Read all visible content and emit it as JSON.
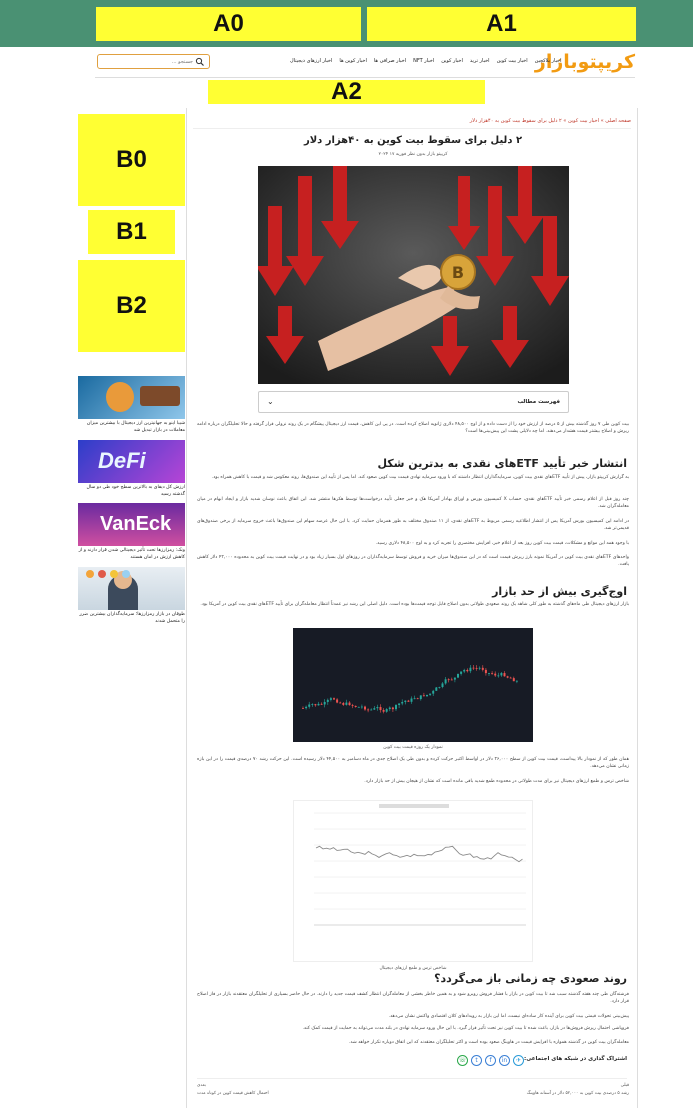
{
  "ads": {
    "a0": "A0",
    "a1": "A1",
    "a2": "A2",
    "b0": "B0",
    "b1": "B1",
    "b2": "B2"
  },
  "header": {
    "logo_a": "کریپتو",
    "logo_b": "بازار",
    "nav": [
      "اخبار ارزهای دیجیتال",
      "اخبار کوین ها",
      "اخبار صرافی ها",
      "اخبار NFT",
      "اخبار کوین",
      "اخبار ترید",
      "اخبار بیت کوین",
      "اخبار بلاکچین"
    ],
    "search_placeholder": "جستجو ..."
  },
  "article": {
    "breadcrumb": "صفحه اصلی » اخبار بیت کوین » ۲ دلیل برای سقوط بیت کوین به ۴۰هزار دلار",
    "title": "۲ دلیل برای سقوط بیت کوین به ۴۰هزار دلار",
    "meta": "کریپتو بازار   بدون نظر   فوریه ۱۷ ۲۰۲۴",
    "toc": "فهرست مطالب",
    "toc_chevron": "⌄",
    "intro": "بیت کوین طی ۷ روز گذشته بیش از ۵ درصد از ارزش خود را از دست داده و از اوج ۴۸,۵۰۰ دلاری ژانویه اصلاح کرده است. در پی این کاهش، قیمت ارز دیجیتال پیشگام در یک روند نزولی قرار گرفته و حالا تحلیلگران درباره ادامه ریزش و اصلاح بیشتر قیمت هشدار می‌دهند. اما چه دلایلی پشت این پیش‌بینی‌ها است؟",
    "h2_1": "انتشار خبر تأیید ETFهای نقدی به بدترین شکل",
    "p1": "به گزارش کریپتو بازار، پیش از تأیید ETFهای نقدی بیت کوین، سرمایه‌گذاران انتظار داشتند که با ورود سرمایه نهادی قیمت بیت کوین صعود کند. اما پس از تأیید این صندوق‌ها، روند معکوس شد و قیمت با کاهش همراه بود.",
    "p2": "چند روز قبل از اعلام رسمی خبر تأیید ETFهای نقدی، حساب X کمیسیون بورس و اوراق بهادار آمریکا هک و خبر جعلی تأیید درخواست‌ها توسط هکرها منتشر شد. این اتفاق باعث نوسان شدید بازار و ایجاد ابهام در میان معامله‌گران شد.",
    "p3": "در ادامه این کمیسیون بورس آمریکا پس از انتشار اطلاعیه رسمی مربوط به ETFهای نقدی، از ۱۱ صندوق مختلف به طور همزمان حمایت کرد. با این حال عرضه سهام این صندوق‌ها باعث خروج سرمایه از برخی صندوق‌های قدیمی‌تر شد.",
    "p4": "با وجود همه این موانع و مشکلات، قیمت بیت کوین روز بعد از اعلام خبر، افزایش مختصری را تجربه کرد و به اوج ۴۸,۵۰۰ دلاری رسید.",
    "p5": "واحدهای ETFهای نقدی بیت کوین در آمریکا نمونه بارز ریزش قیمت است که در این صندوق‌ها میزان خرید و فروش توسط سرمایه‌گذاران در روزهای اول بسیار زیاد بود و در نهایت قیمت بیت کوین به محدوده ۴۲,۰۰۰ دلار کاهش یافت.",
    "h2_2": "اوج‌گیری بیش از حد بازار",
    "p6": "بازار ارزهای دیجیتال طی ماه‌های گذشته به طور کلی شاهد یک روند صعودی طولانی بدون اصلاح قابل توجه قیمت‌ها بوده است. دلیل اصلی این رشد نیز عمدتاً انتظار معامله‌گران برای تأیید ETFهای نقدی بیت کوین در آمریکا بود.",
    "cap1": "نمودار یک روزه قیمت بیت کوین",
    "p7": "همان طور که از نمودار بالا پیداست، قیمت بیت کوین از سطح ۲۶,۰۰۰ دلار در اواسط اکتبر حرکت کرده و بدون طی یک اصلاح جدی در ماه دسامبر به ۴۴,۵۰۰ دلار رسیده است. این حرکت رشد ۷۰ درصدی قیمت را در این بازه زمانی نشان می‌دهد.",
    "p8": "شاخص ترس و طمع ارزهای دیجیتال نیز برای مدت طولانی در محدوده طمع شدید باقی مانده است که نشان از هیجان بیش از حد بازار دارد.",
    "cap2": "شاخص ترس و طمع ارزهای دیجیتال",
    "h2_3": "روند صعودی چه زمانی باز می‌گردد؟",
    "p9": "فرشته‌گان طی چند هفته گذشته سبب شد تا بیت کوین در بازار با فشار فروش روبرو شود و به همین خاطر بخشی از معامله‌گران انتظار کشف قیمت جدید را دارند. در حال حاضر بسیاری از تحلیلگران معتقدند بازار در فاز اصلاح قرار دارد.",
    "p10": "پیش‌بینی تحولات قیمتی بیت کوین برای آینده کار ساده‌ای نیست، اما این بازار به رویدادهای کلان اقتصادی واکنش نشان می‌دهد.",
    "p11": "فروپاشی احتمال ریزش فروش‌ها در بازار، باعث شده تا بیت کوین نیز تحت تأثیر قرار گیرد. با این حال ورود سرمایه نهادی در بلند مدت می‌تواند به حمایت از قیمت کمک کند.",
    "p12": "معامله‌گران بیت کوین در گذشته همواره با افزایش قیمت در هاوینگ صعود بوده است و اکثر تحلیلگران معتقدند که این اتفاق دوباره تکرار خواهد شد.",
    "share": "اشتراک گذاری در شبکه های اجتماعی:",
    "foot1": "قبلی",
    "foot2": "رشد ۵ درصدی بیت کوین به ۵۲,۰۰۰ دلار در آستانه هاوینگ",
    "foot3": "بعدی",
    "foot4": "احتمال کاهش قیمت کوین در کوتاه مدت"
  },
  "sidebar": [
    {
      "caption": "شیبا اینو به جهانیترین ارز دیجیتال با بیشترین میزان معاملات در بازار تبدیل شد"
    },
    {
      "caption": "ارزش کل دیفای به بالاترین سطح خود طی دو سال گذشته رسید"
    },
    {
      "caption": "ونک: رمزارزها تحت تأثیر دیجیتالی شدن قرار دارند و از کاهش ارزش در امان هستند"
    },
    {
      "caption": "طوفان در بازار رمزارزها؛ سرمایه‌گذاران بیشترین ضرر را متحمل شدند"
    }
  ],
  "colors": {
    "brand_green": "#1f7a4d",
    "brand_orange": "#f29b12",
    "ad_yellow": "#ffff33",
    "top_band": "#4a9173"
  }
}
